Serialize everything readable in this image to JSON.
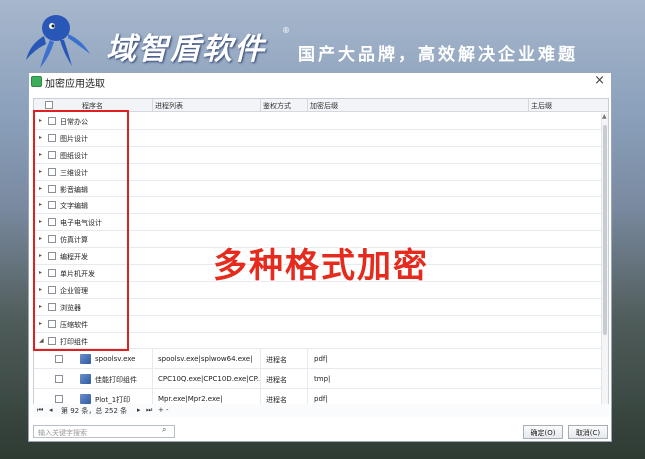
{
  "banner": {
    "brand": "域智盾软件",
    "registered": "®",
    "slogan": "国产大品牌，高效解决企业难题"
  },
  "dialog": {
    "title": "加密应用选取",
    "close_label": "×",
    "columns": [
      "程序名",
      "进程列表",
      "鉴权方式",
      "加密后缀",
      "主后缀"
    ],
    "groups": [
      {
        "label": "日常办公"
      },
      {
        "label": "图片设计"
      },
      {
        "label": "图纸设计"
      },
      {
        "label": "三维设计"
      },
      {
        "label": "影音编辑"
      },
      {
        "label": "文字编辑"
      },
      {
        "label": "电子电气设计"
      },
      {
        "label": "仿真计算"
      },
      {
        "label": "编程开发"
      },
      {
        "label": "单片机开发"
      },
      {
        "label": "企业管理"
      },
      {
        "label": "浏览器"
      },
      {
        "label": "压缩软件"
      },
      {
        "label": "打印组件"
      }
    ],
    "items": [
      {
        "name": "spoolsv.exe",
        "processes": "spoolsv.exe|splwow64.exe|",
        "auth": "进程名",
        "suffix": "pdf|"
      },
      {
        "name": "佳能打印组件",
        "processes": "CPC10Q.exe|CPC10D.exe|CP...",
        "auth": "进程名",
        "suffix": "tmp|"
      },
      {
        "name": "Plot_1打印",
        "processes": "Mpr.exe|Mpr2.exe|",
        "auth": "进程名",
        "suffix": "pdf|"
      }
    ],
    "pager": {
      "first": "⏮",
      "prev": "◂",
      "page_text": "第 92 条，总 252 条",
      "next": "▸",
      "last": "⏭",
      "add": "+",
      "remove": "-"
    },
    "search_placeholder": "输入关键字搜索",
    "ok_label": "确定(O)",
    "cancel_label": "取消(C)"
  },
  "overlay_text": "多种格式加密",
  "colors": {
    "highlight": "#e02020",
    "overlay_text": "#e42b1e",
    "app_icon": "#3cae59"
  }
}
